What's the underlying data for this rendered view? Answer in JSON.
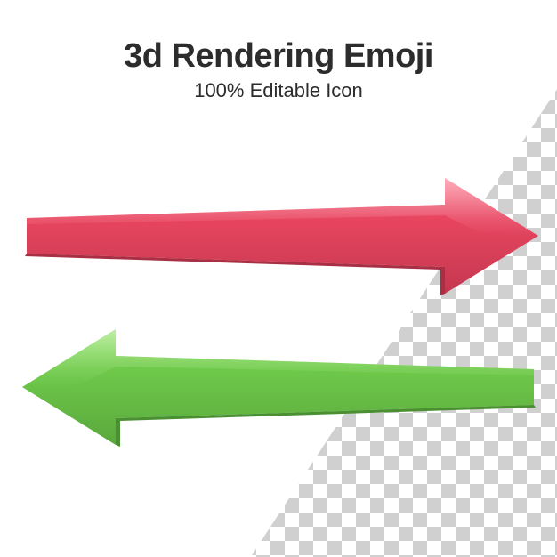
{
  "header": {
    "title": "3d Rendering Emoji",
    "subtitle": "100% Editable Icon"
  },
  "arrows": {
    "red": {
      "color_main": "#e8455f",
      "color_highlight": "#f07a8e",
      "color_shadow": "#c43850",
      "direction": "right"
    },
    "green": {
      "color_main": "#6ec94a",
      "color_highlight": "#8ed96c",
      "color_shadow": "#5aa83c",
      "direction": "left"
    }
  }
}
